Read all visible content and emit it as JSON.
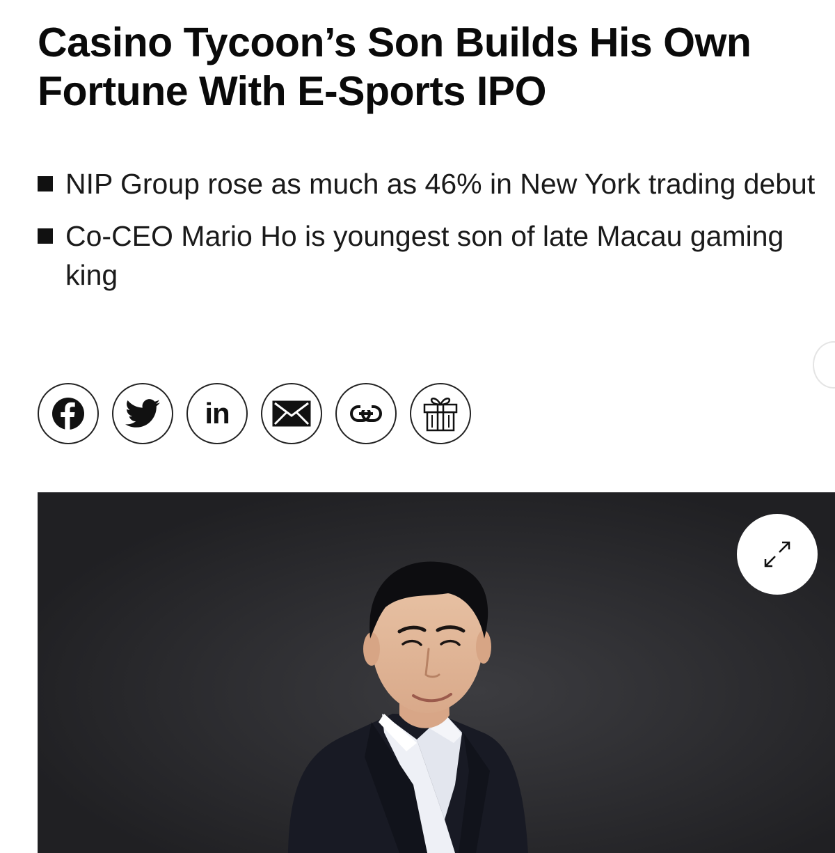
{
  "article": {
    "headline": "Casino Tycoon’s Son Builds His Own Fortune With E-Sports IPO",
    "bullets": [
      "NIP Group rose as much as 46% in New York trading debut",
      "Co-CEO Mario Ho is youngest son of late Macau gaming king"
    ]
  },
  "share": {
    "icons": [
      "facebook-icon",
      "twitter-icon",
      "linkedin-icon",
      "email-icon",
      "link-icon",
      "gift-icon"
    ],
    "linkedin_text": "in"
  },
  "media": {
    "expand_icon": "expand-arrows-icon"
  },
  "colors": {
    "text": "#111111",
    "photo_background": "#2b2b2e"
  }
}
